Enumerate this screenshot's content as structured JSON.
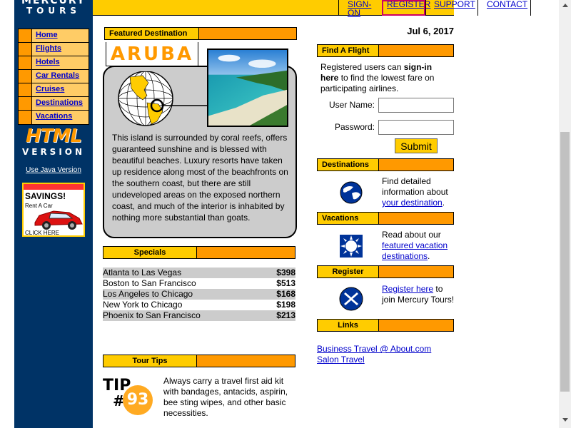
{
  "logo": {
    "line1": "MERCURY",
    "line2": "TOURS"
  },
  "nav": {
    "items": [
      {
        "label": "Home"
      },
      {
        "label": "Flights"
      },
      {
        "label": "Hotels"
      },
      {
        "label": "Car Rentals"
      },
      {
        "label": "Cruises"
      },
      {
        "label": "Destinations"
      },
      {
        "label": "Vacations"
      }
    ]
  },
  "html_version": {
    "big": "HTML",
    "small": "VERSION",
    "java_link": "Use Java Version"
  },
  "ad": {
    "title": "SAVINGS!",
    "subtitle": "Rent A Car",
    "cta": "CLICK HERE"
  },
  "top_nav": {
    "signon": "SIGN-ON",
    "register": "REGISTER",
    "support": "SUPPORT",
    "contact": "CONTACT"
  },
  "date": "Jul 6, 2017",
  "featured": {
    "header": "Featured Destination",
    "name": "ARUBA",
    "description": "This island is surrounded by coral reefs, offers guaranteed sunshine and is blessed with beautiful beaches. Luxury resorts have taken up residence along most of the beachfronts on the southern coast, but there are still undeveloped areas on the exposed northern coast, and much of the interior is inhabited by nothing more substantial than goats."
  },
  "specials": {
    "header": "Specials",
    "rows": [
      {
        "route": "Atlanta to Las Vegas",
        "price": "$398"
      },
      {
        "route": "Boston to San Francisco",
        "price": "$513"
      },
      {
        "route": "Los Angeles to Chicago",
        "price": "$168"
      },
      {
        "route": "New York to Chicago",
        "price": "$198"
      },
      {
        "route": "Phoenix to San Francisco",
        "price": "$213"
      }
    ]
  },
  "tips": {
    "header": "Tour Tips",
    "tip_label": "TIP",
    "tip_hash": "#",
    "tip_number": "93",
    "text": "Always carry a travel first aid kit with bandages, antacids, aspirin, bee sting wipes, and other basic necessities."
  },
  "find_flight": {
    "header": "Find A Flight",
    "intro_pre": "Registered users can ",
    "intro_bold": "sign-in here",
    "intro_post": " to find the lowest fare on participating airlines.",
    "username_label": "User Name:",
    "password_label": "Password:",
    "submit": "Submit"
  },
  "destinations": {
    "header": "Destinations",
    "text_pre": "Find detailed information about ",
    "link": "your destination",
    "text_post": "."
  },
  "vacations": {
    "header": "Vacations",
    "text_pre": "Read about our ",
    "link": "featured vacation destinations",
    "text_post": "."
  },
  "register": {
    "header": "Register",
    "link": "Register here",
    "text_post": " to join Mercury Tours!"
  },
  "links": {
    "header": "Links",
    "items": [
      "Business Travel @ About.com",
      "Salon Travel"
    ]
  },
  "colors": {
    "navy": "#003366",
    "gold": "#ffcc00",
    "orange": "#ff9900",
    "link": "#0000cc"
  }
}
